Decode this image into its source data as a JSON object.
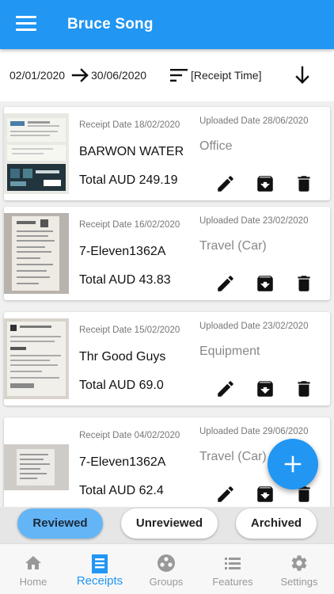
{
  "app_bar": {
    "title": "Bruce Song",
    "menu_icon": "menu-icon"
  },
  "filters": {
    "date_from": "02/01/2020",
    "date_to": "30/06/2020",
    "sort_label": "[Receipt Time]",
    "sort_icon": "sort-icon",
    "direction_icon": "arrow-down-icon"
  },
  "receipts": [
    {
      "receipt_date": "Receipt Date 18/02/2020",
      "uploaded_date": "Uploaded Date 28/06/2020",
      "merchant": "BARWON WATER",
      "category": "Office",
      "total": "Total AUD 249.19"
    },
    {
      "receipt_date": "Receipt Date 16/02/2020",
      "uploaded_date": "Uploaded Date 23/02/2020",
      "merchant": "7-Eleven1362A",
      "category": "Travel (Car)",
      "total": "Total AUD 43.83"
    },
    {
      "receipt_date": "Receipt Date 15/02/2020",
      "uploaded_date": "Uploaded Date 23/02/2020",
      "merchant": "Thr Good Guys",
      "category": "Equipment",
      "total": "Total AUD 69.0"
    },
    {
      "receipt_date": "Receipt Date 04/02/2020",
      "uploaded_date": "Uploaded Date 29/06/2020",
      "merchant": "7-Eleven1362A",
      "category": "Travel (Car)",
      "total": "Total AUD 62.4"
    }
  ],
  "actions": {
    "edit_icon": "pencil-icon",
    "archive_icon": "archive-icon",
    "delete_icon": "trash-icon"
  },
  "fab": {
    "icon": "plus-icon"
  },
  "status_filters": {
    "reviewed": "Reviewed",
    "unreviewed": "Unreviewed",
    "archived": "Archived",
    "selected": "Reviewed"
  },
  "bottom_nav": {
    "items": [
      {
        "label": "Home",
        "icon": "home-icon"
      },
      {
        "label": "Receipts",
        "icon": "receipt-icon"
      },
      {
        "label": "Groups",
        "icon": "groups-icon"
      },
      {
        "label": "Features",
        "icon": "features-icon"
      },
      {
        "label": "Settings",
        "icon": "gear-icon"
      }
    ],
    "active": "Receipts"
  },
  "colors": {
    "primary": "#2196f3",
    "chip_selected": "#64b5f6",
    "muted_text": "#777777"
  }
}
